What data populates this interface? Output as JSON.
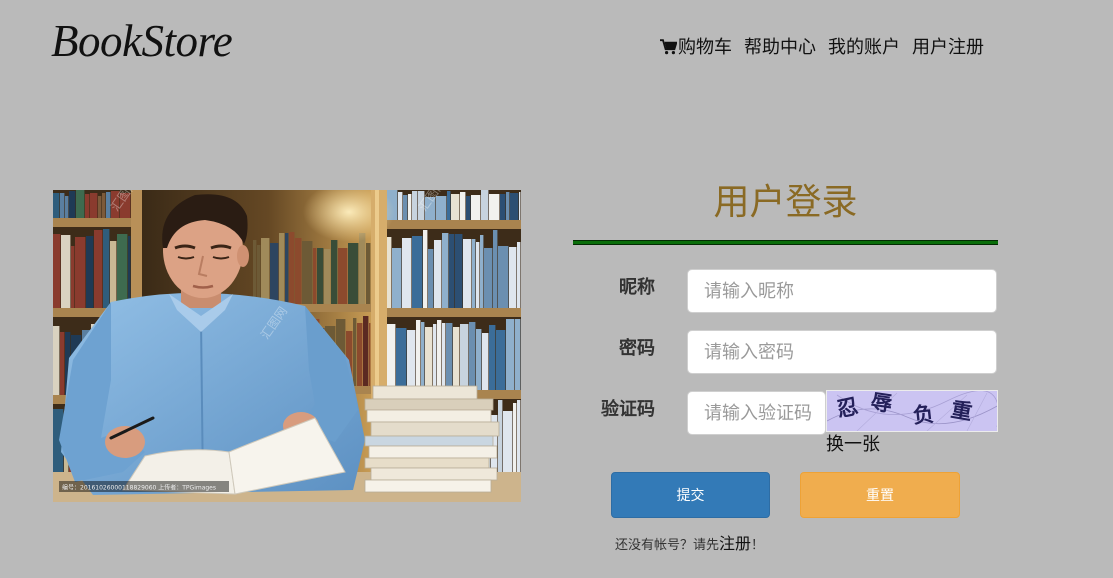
{
  "logo": {
    "text": "BookStore"
  },
  "nav": {
    "items": [
      {
        "label": "购物车",
        "icon": "cart-icon"
      },
      {
        "label": "帮助中心"
      },
      {
        "label": "我的账户"
      },
      {
        "label": "用户注册"
      }
    ]
  },
  "photo": {
    "watermark_caption": "编号：20161026000118829060 上传者：TPGimages",
    "watermark_brand": "汇图网"
  },
  "login": {
    "title": "用户登录",
    "fields": [
      {
        "label": "昵称",
        "placeholder": "请输入昵称"
      },
      {
        "label": "密码",
        "placeholder": "请输入密码"
      },
      {
        "label": "验证码",
        "placeholder": "请输入验证码"
      }
    ],
    "captcha": {
      "chars": [
        "忍",
        "辱",
        "负",
        "重"
      ],
      "refresh_label": "换一张"
    },
    "submit_label": "提交",
    "reset_label": "重置",
    "register_prompt": {
      "prefix": "还没有帐号？请先",
      "link": "注册",
      "suffix": "！"
    }
  },
  "colors": {
    "background": "#bababa",
    "title": "#8a6a24",
    "divider": "#0a6e0a",
    "submit_button": "#337ab7",
    "reset_button": "#f0ad4e"
  }
}
